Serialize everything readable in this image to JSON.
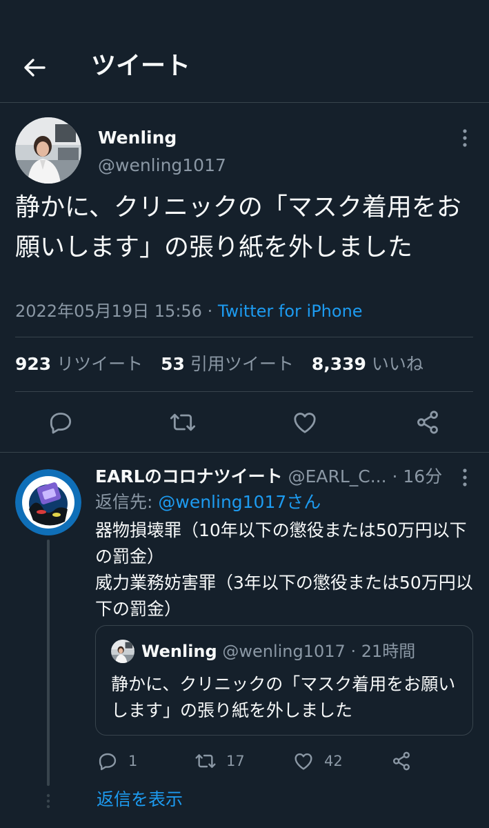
{
  "header": {
    "title": "ツイート",
    "back_icon": "arrow-left-icon"
  },
  "tweet": {
    "display_name": "Wenling",
    "handle": "@wenling1017",
    "text": "静かに、クリニックの「マスク着用をお願いします」の張り紙を外しました",
    "timestamp": "2022年05月19日 15:56",
    "separator": " · ",
    "source": "Twitter for iPhone",
    "stats": {
      "retweets_count": "923",
      "retweets_label": "リツイート",
      "quotes_count": "53",
      "quotes_label": "引用ツイート",
      "likes_count": "8,339",
      "likes_label": "いいね"
    },
    "actions": [
      "reply-icon",
      "retweet-icon",
      "like-icon",
      "share-icon"
    ]
  },
  "reply": {
    "display_name": "EARLのコロナツイート",
    "handle": "@EARL_C...",
    "separator": " · ",
    "time": "16分",
    "reply_to_prefix": "返信先: ",
    "reply_to_handle": "@wenling1017さん",
    "lines": [
      "器物損壊罪（10年以下の懲役または50万円以下の罰金）",
      "威力業務妨害罪（3年以下の懲役または50万円以下の罰金）"
    ],
    "quote": {
      "display_name": "Wenling",
      "handle": "@wenling1017",
      "separator": " · ",
      "time": "21時間",
      "text": "静かに、クリニックの「マスク着用をお願いします」の張り紙を外しました"
    },
    "actions": {
      "replies": "1",
      "retweets": "17",
      "likes": "42"
    }
  },
  "show_replies": "返信を表示",
  "colors": {
    "background": "#15202b",
    "accent": "#1d9bf0",
    "muted": "#8b98a5",
    "divider": "#38444d"
  }
}
